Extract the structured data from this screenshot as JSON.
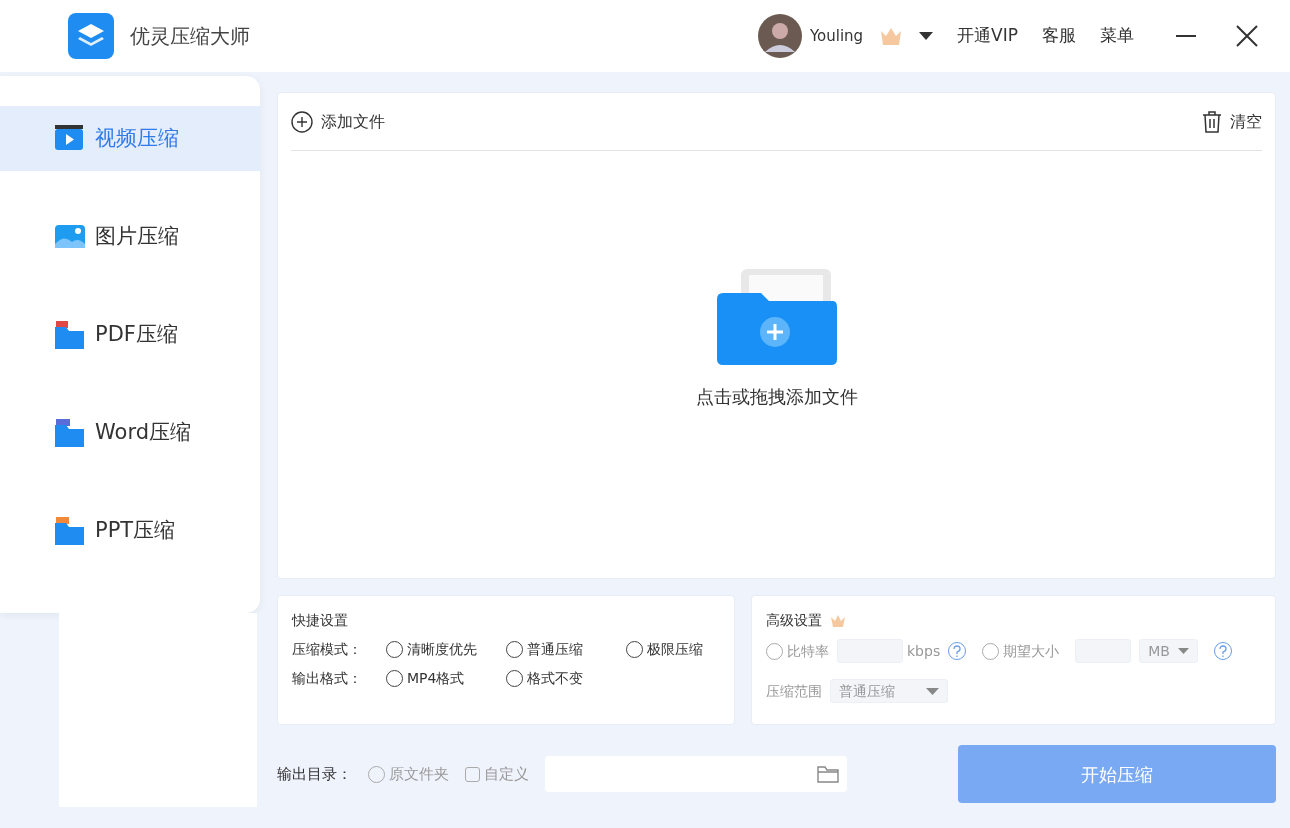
{
  "app": {
    "title": "优灵压缩大师"
  },
  "user": {
    "name": "Youling"
  },
  "header_links": [
    "开通VIP",
    "客服",
    "菜单"
  ],
  "sidebar": {
    "items": [
      {
        "label": "视频压缩",
        "kind": "video",
        "selected": true
      },
      {
        "label": "图片压缩",
        "kind": "image",
        "selected": false
      },
      {
        "label": "PDF压缩",
        "kind": "pdf",
        "selected": false
      },
      {
        "label": "Word压缩",
        "kind": "word",
        "selected": false
      },
      {
        "label": "PPT压缩",
        "kind": "ppt",
        "selected": false
      }
    ]
  },
  "toolbar": {
    "add_file": "添加文件",
    "clear": "清空"
  },
  "drop_zone": {
    "hint": "点击或拖拽添加文件"
  },
  "quick_settings": {
    "title": "快捷设置",
    "rows": [
      {
        "label": "压缩模式：",
        "options": [
          {
            "label": "清晰度优先",
            "selected": false
          },
          {
            "label": "普通压缩",
            "selected": false
          },
          {
            "label": "极限压缩",
            "selected": false
          }
        ]
      },
      {
        "label": "输出格式：",
        "options": [
          {
            "label": "MP4格式",
            "selected": false
          },
          {
            "label": "格式不变",
            "selected": false
          }
        ]
      }
    ]
  },
  "advanced_settings": {
    "title": "高级设置",
    "disabled": true,
    "bitrate": {
      "label": "比特率",
      "unit": "kbps",
      "selected": false
    },
    "size": {
      "label": "期望大小",
      "unit": "MB",
      "selected": false
    },
    "range": {
      "label": "压缩范围",
      "value": "普通压缩"
    }
  },
  "output": {
    "label": "输出目录：",
    "options": [
      {
        "kind": "radio",
        "label": "原文件夹",
        "selected": false
      },
      {
        "kind": "checkbox",
        "label": "自定义",
        "selected": false
      }
    ]
  },
  "start_button": {
    "label": "开始压缩",
    "disabled": true
  }
}
